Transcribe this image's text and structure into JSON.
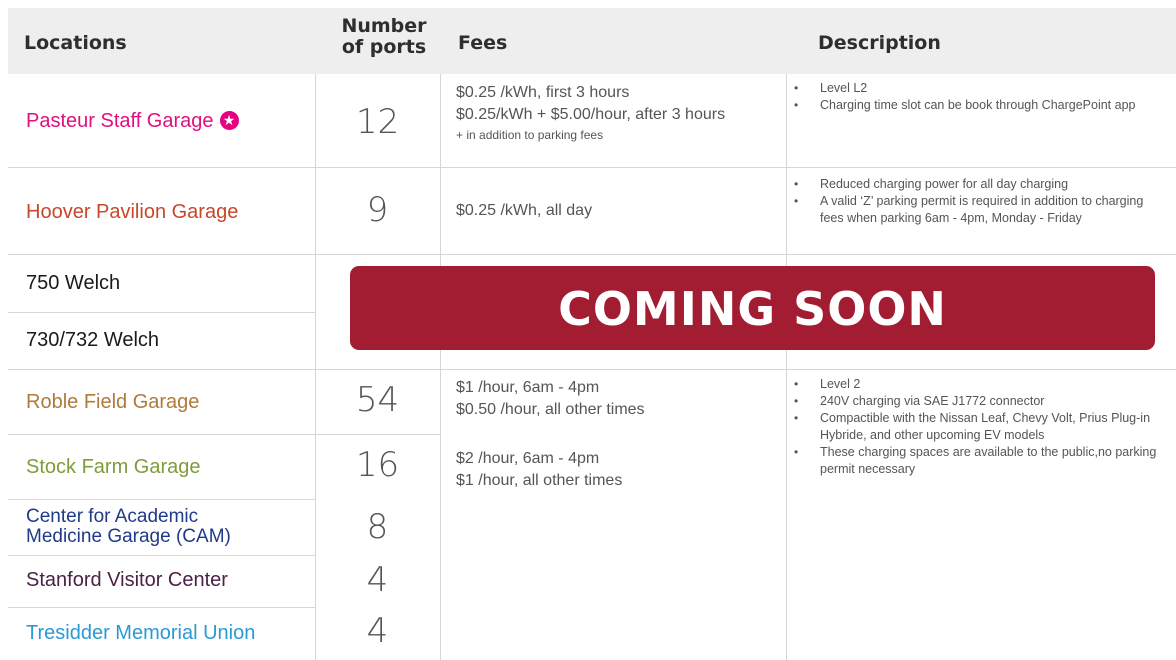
{
  "header": {
    "locations": "Locations",
    "ports_line1": "Number",
    "ports_line2": "of ports",
    "fees": "Fees",
    "description": "Description"
  },
  "rows": [
    {
      "location": "Pasteur Staff Garage",
      "color": "#e0107f",
      "badge": "★",
      "ports": "12",
      "fees": [
        "$0.25 /kWh, first 3 hours",
        "$0.25/kWh + $5.00/hour, after 3 hours"
      ],
      "fee_note": "+ in addition to parking fees",
      "description": [
        "Level L2",
        "Charging time slot can be book through ChargePoint app"
      ]
    },
    {
      "location": "Hoover Pavilion Garage",
      "color": "#c8472a",
      "ports": "9",
      "fees": [
        "$0.25 /kWh, all day"
      ],
      "description": [
        "Reduced charging power for all day charging",
        "A valid ‘Z’ parking permit is required in addition to charging fees when parking 6am - 4pm, Monday - Friday"
      ]
    },
    {
      "location": "750 Welch",
      "color": "#1a1a1a"
    },
    {
      "location": "730/732 Welch",
      "color": "#1a1a1a"
    },
    {
      "location": "Roble Field Garage",
      "color": "#b07a3a",
      "ports": "54",
      "fees": [
        "$1 /hour, 6am - 4pm",
        "$0.50 /hour, all other times"
      ]
    },
    {
      "location": "Stock Farm Garage",
      "color": "#7e9c3a",
      "ports": "16",
      "fees": [
        "$2 /hour, 6am - 4pm",
        "$1 /hour, all other times"
      ]
    },
    {
      "location": "Center for Academic Medicine Garage (CAM)",
      "color": "#1f3a8a",
      "ports": "8"
    },
    {
      "location": "Stanford Visitor Center",
      "color": "#4a2245",
      "ports": "4"
    },
    {
      "location": "Tresidder Memorial Union",
      "color": "#2a9ad6",
      "ports": "4"
    }
  ],
  "shared_description": [
    "Level 2",
    "240V charging via SAE J1772 connector",
    "Compactible with the Nissan Leaf, Chevy Volt, Prius Plug-in Hybride, and other upcoming EV models",
    "These charging spaces are available to the public,no parking permit necessary"
  ],
  "banner": "COMING SOON"
}
